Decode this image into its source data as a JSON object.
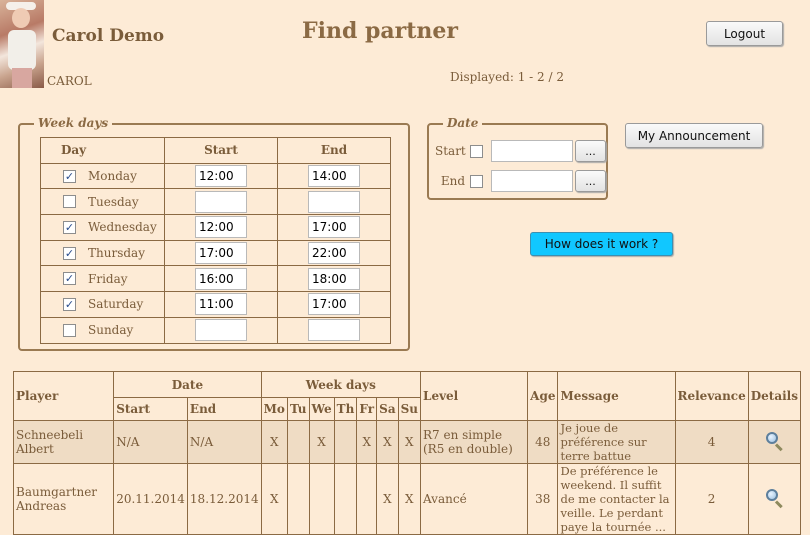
{
  "header": {
    "user_name": "Carol Demo",
    "user_login": "CAROL",
    "page_title": "Find partner",
    "displayed": "Displayed: 1 - 2 / 2",
    "logout_label": "Logout"
  },
  "week_days": {
    "legend": "Week days",
    "col_day": "Day",
    "col_start": "Start",
    "col_end": "End",
    "days": [
      {
        "name": "Monday",
        "checked": true,
        "start": "12:00",
        "end": "14:00"
      },
      {
        "name": "Tuesday",
        "checked": false,
        "start": "",
        "end": ""
      },
      {
        "name": "Wednesday",
        "checked": true,
        "start": "12:00",
        "end": "17:00"
      },
      {
        "name": "Thursday",
        "checked": true,
        "start": "17:00",
        "end": "22:00"
      },
      {
        "name": "Friday",
        "checked": true,
        "start": "16:00",
        "end": "18:00"
      },
      {
        "name": "Saturday",
        "checked": true,
        "start": "11:00",
        "end": "17:00"
      },
      {
        "name": "Sunday",
        "checked": false,
        "start": "",
        "end": ""
      }
    ]
  },
  "date_filter": {
    "legend": "Date",
    "start_label": "Start",
    "end_label": "End",
    "picker_label": "...",
    "start_value": "",
    "end_value": ""
  },
  "actions": {
    "announcement_label": "My Announcement",
    "how_label": "How does it work ?"
  },
  "results": {
    "headers": {
      "player": "Player",
      "date": "Date",
      "start": "Start",
      "end": "End",
      "week_days": "Week days",
      "mo": "Mo",
      "tu": "Tu",
      "we": "We",
      "th": "Th",
      "fr": "Fr",
      "sa": "Sa",
      "su": "Su",
      "level": "Level",
      "age": "Age",
      "message": "Message",
      "relevance": "Relevance",
      "details": "Details"
    },
    "rows": [
      {
        "player": "Schneebeli Albert",
        "start": "N/A",
        "end": "N/A",
        "mo": "X",
        "tu": "",
        "we": "X",
        "th": "",
        "fr": "X",
        "sa": "X",
        "su": "X",
        "level": "R7 en simple (R5 en double)",
        "age": "48",
        "message": "Je joue de préférence sur terre battue",
        "relevance": "4",
        "details_icon": "magnifier-icon"
      },
      {
        "player": "Baumgartner Andreas",
        "start": "20.11.2014",
        "end": "18.12.2014",
        "mo": "X",
        "tu": "",
        "we": "",
        "th": "",
        "fr": "",
        "sa": "X",
        "su": "X",
        "level": "Avancé",
        "age": "38",
        "message": "De préférence le weekend. Il suffit de me contacter la veille. Le perdant paye la tournée ...",
        "relevance": "2",
        "details_icon": "magnifier-icon"
      }
    ]
  },
  "colors": {
    "background": "#fdebd6",
    "text": "#7a5c3a",
    "border": "#8b6a44",
    "highlight_row": "#efdcc4",
    "how_button": "#11c7ff"
  }
}
